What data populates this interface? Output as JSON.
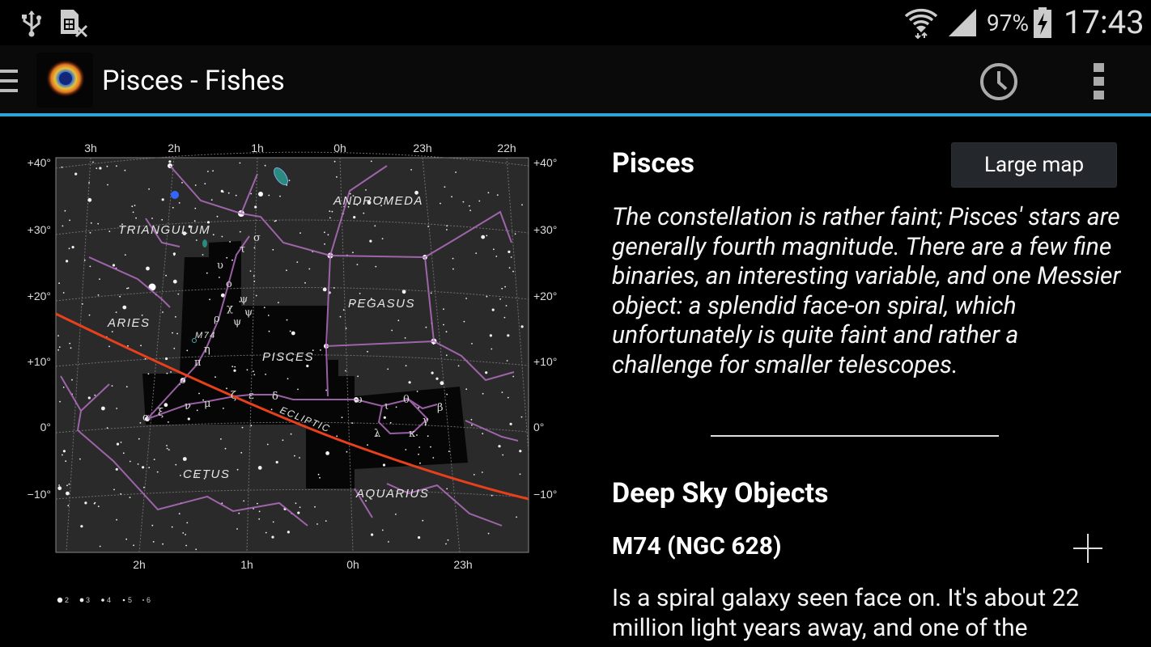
{
  "status_bar": {
    "battery": "97%",
    "time": "17:43"
  },
  "app_bar": {
    "title": "Pisces - Fishes"
  },
  "map": {
    "ra_top": [
      "3h",
      "2h",
      "1h",
      "0h",
      "23h",
      "22h"
    ],
    "ra_bottom": [
      "2h",
      "1h",
      "0h",
      "23h"
    ],
    "dec_labels": [
      "+40°",
      "+30°",
      "+20°",
      "+10°",
      "0°",
      "−10°"
    ],
    "constellations": [
      "ANDROMEDA",
      "TRIANGULUM",
      "PEGASUS",
      "ARIES",
      "PISCES",
      "CETUS",
      "AQUARIUS"
    ],
    "ecliptic": "ECLIPTIC",
    "object_label": "M74",
    "legend": [
      "2",
      "3",
      "4",
      "5",
      "6"
    ]
  },
  "detail": {
    "constellation_name": "Pisces",
    "large_map_label": "Large map",
    "description": "The constellation is rather faint; Pisces' stars are generally fourth magnitude. There are a few fine binaries, an interesting variable, and one Messier object: a splendid face-on spiral, which unfortunately is quite faint and rather a challenge for smaller telescopes.",
    "section_title": "Deep Sky Objects",
    "objects": [
      {
        "name": "M74 (NGC 628)",
        "description": "Is a spiral galaxy seen face on. It's about 22 million light years away, and one of the"
      }
    ]
  },
  "colors": {
    "accent": "#2fa3d8",
    "ecliptic": "#e8401c",
    "constellation_lines": "#b36fc0",
    "button_bg": "#24272b"
  }
}
